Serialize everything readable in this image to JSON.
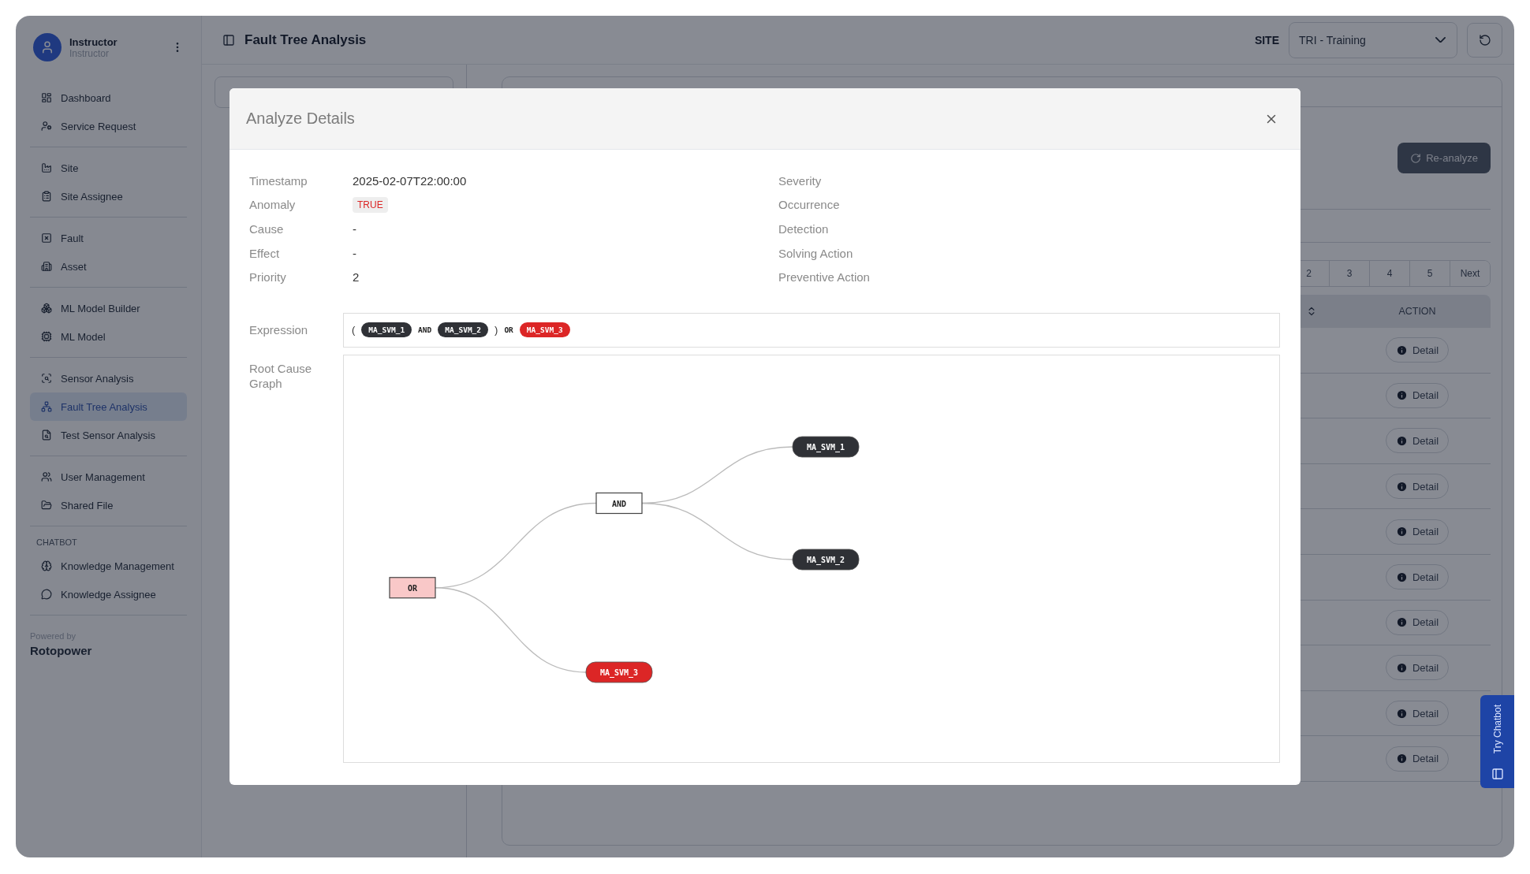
{
  "sidebar": {
    "user": {
      "name": "Instructor",
      "role": "Instructor"
    },
    "groups": [
      {
        "items": [
          {
            "label": "Dashboard",
            "selected": false
          },
          {
            "label": "Service Request",
            "selected": false
          }
        ]
      },
      {
        "items": [
          {
            "label": "Site",
            "selected": false
          },
          {
            "label": "Site Assignee",
            "selected": false
          }
        ]
      },
      {
        "items": [
          {
            "label": "Fault",
            "selected": false
          },
          {
            "label": "Asset",
            "selected": false
          }
        ]
      },
      {
        "items": [
          {
            "label": "ML Model Builder",
            "selected": false
          },
          {
            "label": "ML Model",
            "selected": false
          }
        ]
      },
      {
        "items": [
          {
            "label": "Sensor Analysis",
            "selected": false
          },
          {
            "label": "Fault Tree Analysis",
            "selected": true
          },
          {
            "label": "Test Sensor Analysis",
            "selected": false
          }
        ]
      },
      {
        "items": [
          {
            "label": "User Management",
            "selected": false
          },
          {
            "label": "Shared File",
            "selected": false
          }
        ]
      },
      {
        "title": "CHATBOT",
        "items": [
          {
            "label": "Knowledge Management",
            "selected": false
          },
          {
            "label": "Knowledge Assignee",
            "selected": false
          }
        ]
      }
    ],
    "powered_by": {
      "label": "Powered by",
      "brand": "Rotopower"
    }
  },
  "header": {
    "title": "Fault Tree Analysis",
    "site_label": "SITE",
    "site_value": "TRI - Training"
  },
  "toolbar": {
    "reanalyze": "Re-analyze"
  },
  "pagination": [
    "2",
    "3",
    "4",
    "5",
    "Next"
  ],
  "table": {
    "columns": [
      "ACTION"
    ],
    "rows": [
      {
        "action": "Detail"
      },
      {
        "action": "Detail"
      },
      {
        "action": "Detail"
      },
      {
        "action": "Detail"
      },
      {
        "action": "Detail"
      },
      {
        "action": "Detail"
      },
      {
        "action": "Detail"
      },
      {
        "action": "Detail"
      },
      {
        "action": "Detail"
      },
      {
        "action": "Detail"
      }
    ]
  },
  "chatbot_tab": "Try Chatbot",
  "modal": {
    "title": "Analyze Details",
    "fields_left": [
      {
        "label": "Timestamp",
        "value": "2025-02-07T22:00:00",
        "kind": "text"
      },
      {
        "label": "Anomaly",
        "value": "TRUE",
        "kind": "badge"
      },
      {
        "label": "Cause",
        "value": "-",
        "kind": "text"
      },
      {
        "label": "Effect",
        "value": "-",
        "kind": "text"
      },
      {
        "label": "Priority",
        "value": "2",
        "kind": "text"
      }
    ],
    "fields_right": [
      {
        "label": "Severity"
      },
      {
        "label": "Occurrence"
      },
      {
        "label": "Detection"
      },
      {
        "label": "Solving Action"
      },
      {
        "label": "Preventive Action"
      }
    ],
    "expression": {
      "label": "Expression",
      "tokens": [
        {
          "kind": "paren",
          "text": "("
        },
        {
          "kind": "var",
          "text": "MA_SVM_1",
          "active": false
        },
        {
          "kind": "op",
          "text": "AND"
        },
        {
          "kind": "var",
          "text": "MA_SVM_2",
          "active": false
        },
        {
          "kind": "paren",
          "text": ")"
        },
        {
          "kind": "op",
          "text": "OR"
        },
        {
          "kind": "var",
          "text": "MA_SVM_3",
          "active": true
        }
      ]
    },
    "graph": {
      "label": "Root Cause Graph",
      "root": {
        "label": "OR",
        "kind": "gate",
        "active": true,
        "children": [
          {
            "label": "AND",
            "kind": "gate",
            "active": false,
            "children": [
              {
                "label": "MA_SVM_1",
                "kind": "signal",
                "active": false
              },
              {
                "label": "MA_SVM_2",
                "kind": "signal",
                "active": false
              }
            ]
          },
          {
            "label": "MA_SVM_3",
            "kind": "signal",
            "active": true
          }
        ]
      }
    }
  }
}
